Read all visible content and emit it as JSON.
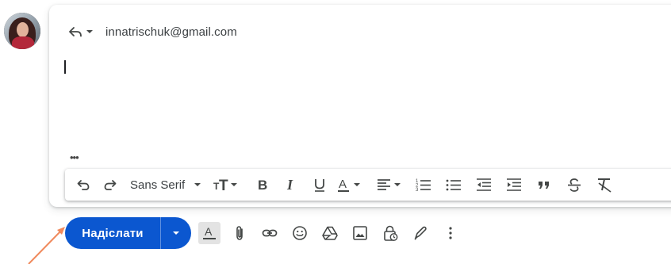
{
  "reply_header": {
    "recipient": "innatrischuk@gmail.com",
    "reply_icon": "reply-icon",
    "reply_type_menu_icon": "caret-down-icon"
  },
  "body": {
    "text": "",
    "show_trimmed_icon": "more-horiz-icon"
  },
  "formatting_toolbar": {
    "undo_icon": "undo-icon",
    "redo_icon": "redo-icon",
    "font_family": "Sans Serif",
    "font_size_icon": "text-size-icon",
    "bold_icon": "bold-icon",
    "italic_icon": "italic-icon",
    "underline_icon": "underline-icon",
    "text_color_icon": "text-color-icon",
    "align_icon": "align-left-icon",
    "numbered_list_icon": "numbered-list-icon",
    "bulleted_list_icon": "bulleted-list-icon",
    "indent_less_icon": "indent-less-icon",
    "indent_more_icon": "indent-more-icon",
    "quote_icon": "quote-icon",
    "strikethrough_icon": "strikethrough-icon",
    "remove_formatting_icon": "remove-formatting-icon"
  },
  "send": {
    "label": "Надіслати",
    "options_icon": "caret-down-icon",
    "color": "#0b57d0"
  },
  "bottom_toolbar": {
    "items": [
      "formatting-options-icon",
      "attach-icon",
      "link-icon",
      "emoji-icon",
      "drive-icon",
      "photo-icon",
      "confidential-mode-icon",
      "signature-icon",
      "more-options-icon"
    ]
  },
  "annotation": {
    "arrow_color": "#f08a5d"
  }
}
